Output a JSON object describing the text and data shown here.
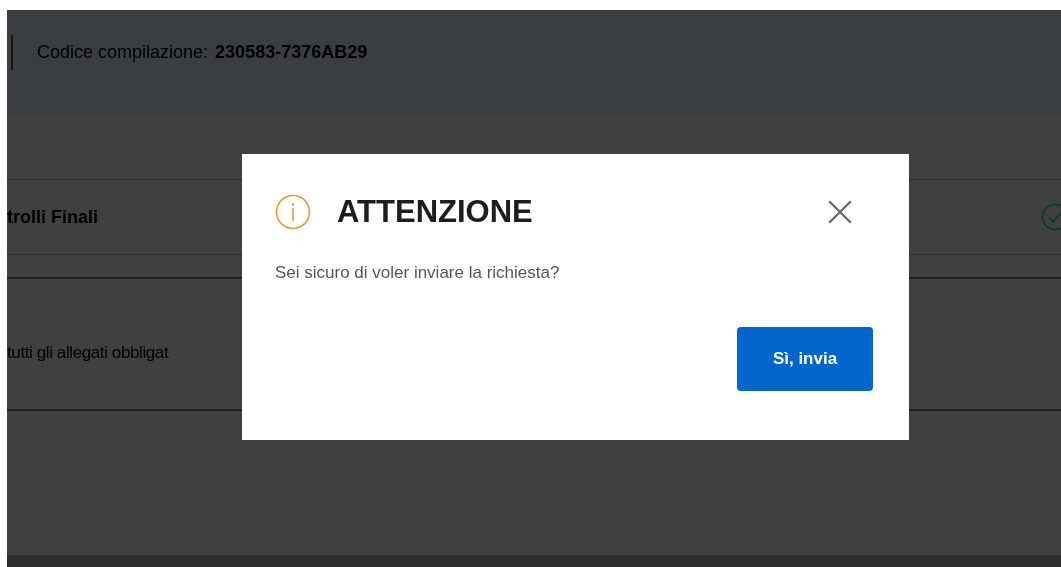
{
  "header": {
    "code_label": "Codice compilazione:",
    "code_value": "230583-7376AB29"
  },
  "section": {
    "title": "trolli Finali",
    "completed": true,
    "note": "tutti gli allegati obbligat"
  },
  "dialog": {
    "title": "ATTENZIONE",
    "message": "Sei sicuro di voler inviare la richiesta?",
    "confirm": "Sì, invia"
  }
}
